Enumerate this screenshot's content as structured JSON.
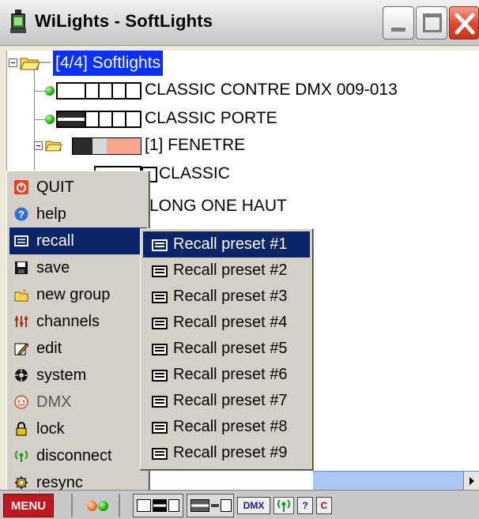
{
  "window": {
    "title": "WiLights - SoftLights"
  },
  "tree": {
    "root_label": "[4/4] Softlights",
    "items": [
      {
        "label": "CLASSIC CONTRE  DMX  009-013"
      },
      {
        "label": "CLASSIC PORTE"
      },
      {
        "label": "[1] FENETRE"
      },
      {
        "label": "CLASSIC"
      },
      {
        "label": "LONG ONE HAUT"
      }
    ]
  },
  "main_menu": {
    "items": [
      {
        "label": "QUIT",
        "icon": "quit-icon"
      },
      {
        "label": "help",
        "icon": "help-icon"
      },
      {
        "label": "recall",
        "icon": "recall-icon",
        "highlighted": true
      },
      {
        "label": "save",
        "icon": "save-icon"
      },
      {
        "label": "new group",
        "icon": "new-group-icon"
      },
      {
        "label": "channels",
        "icon": "channels-icon"
      },
      {
        "label": "edit",
        "icon": "edit-icon"
      },
      {
        "label": "system",
        "icon": "system-icon"
      },
      {
        "label": "DMX",
        "icon": "dmx-icon"
      },
      {
        "label": "lock",
        "icon": "lock-icon"
      },
      {
        "label": "disconnect",
        "icon": "disconnect-icon"
      },
      {
        "label": "resync",
        "icon": "resync-icon"
      }
    ]
  },
  "recall_submenu": {
    "items": [
      {
        "label": "Recall preset #1"
      },
      {
        "label": "Recall preset #2"
      },
      {
        "label": "Recall preset #3"
      },
      {
        "label": "Recall preset #4"
      },
      {
        "label": "Recall preset #5"
      },
      {
        "label": "Recall preset #6"
      },
      {
        "label": "Recall preset #7"
      },
      {
        "label": "Recall preset #8"
      },
      {
        "label": "Recall preset #9"
      }
    ]
  },
  "statusbar": {
    "menu_label": "MENU",
    "dmx_label": "DMX",
    "help_label": "?",
    "c_label": "C"
  },
  "colors": {
    "selection": "#0a30ff",
    "menu_highlight": "#0a246a",
    "menu_button": "#c0181e",
    "salmon": "#f5a58e",
    "status_on": "#19a90e"
  }
}
